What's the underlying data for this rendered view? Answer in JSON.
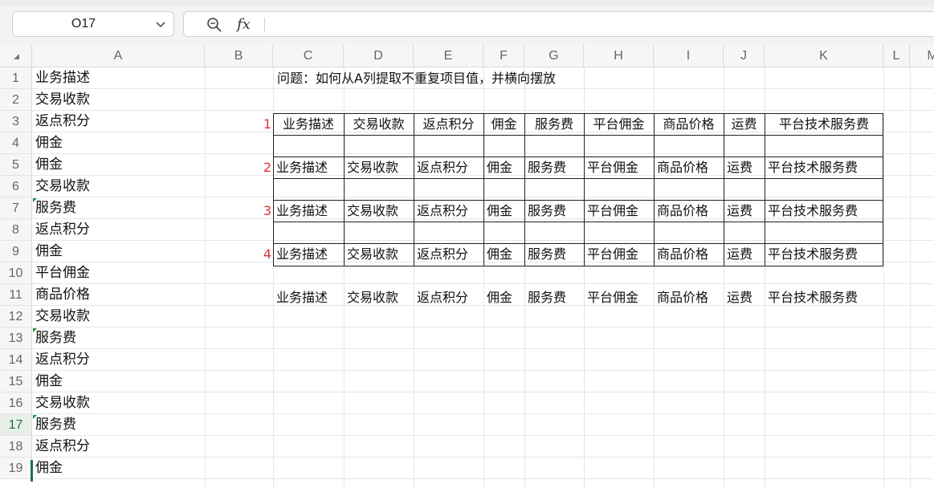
{
  "name_box": {
    "value": "O17"
  },
  "formula_bar": {
    "value": "",
    "zoom_icon": "zoom-icon",
    "fx_label": "fx"
  },
  "columns": [
    "A",
    "B",
    "C",
    "D",
    "E",
    "F",
    "G",
    "H",
    "I",
    "J",
    "K",
    "L",
    "M"
  ],
  "rows": [
    "1",
    "2",
    "3",
    "4",
    "5",
    "6",
    "7",
    "8",
    "9",
    "10",
    "11",
    "12",
    "13",
    "14",
    "15",
    "16",
    "17",
    "18",
    "19"
  ],
  "active_row": "17",
  "colA": [
    "业务描述",
    "交易收款",
    "返点积分",
    "佣金",
    "佣金",
    "交易收款",
    " 服务费",
    "返点积分",
    "佣金",
    "平台佣金",
    "商品价格",
    "交易收款",
    " 服务费",
    "返点积分",
    "佣金",
    "交易收款",
    " 服务费",
    "返点积分",
    "佣金"
  ],
  "question": "问题：如何从A列提取不重复项目值，并横向摆放",
  "table": {
    "headers": [
      "业务描述",
      "交易收款",
      "返点积分",
      "佣金",
      "服务费",
      "平台佣金",
      "商品价格",
      "运费",
      "平台技术服务费"
    ],
    "results": [
      {
        "label": "1",
        "values": [
          "业务描述",
          "交易收款",
          "返点积分",
          "佣金",
          "服务费",
          "平台佣金",
          "商品价格",
          "运费",
          "平台技术服务费"
        ]
      },
      {
        "label": "2",
        "values": [
          "业务描述",
          "交易收款",
          "返点积分",
          "佣金",
          "服务费",
          "平台佣金",
          "商品价格",
          "运费",
          "平台技术服务费"
        ]
      },
      {
        "label": "3",
        "values": [
          "业务描述",
          "交易收款",
          "返点积分",
          "佣金",
          "服务费",
          "平台佣金",
          "商品价格",
          "运费",
          "平台技术服务费"
        ]
      },
      {
        "label": "4",
        "values": [
          "业务描述",
          "交易收款",
          "返点积分",
          "佣金",
          "服务费",
          "平台佣金",
          "商品价格",
          "运费",
          "平台技术服务费"
        ]
      }
    ]
  },
  "colors": {
    "accent": "#1e7145",
    "row_label": "#e03030",
    "error_triangle": "#1e8b3e"
  }
}
